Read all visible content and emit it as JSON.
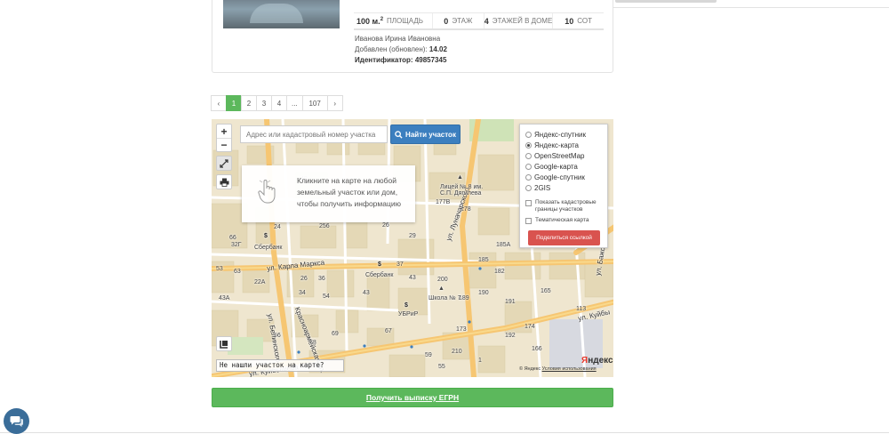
{
  "listing": {
    "area_value": "100 м.",
    "area_sup": "2",
    "area_label": "ПЛОЩАДЬ",
    "floor_value": "0",
    "floor_label": "ЭТАЖ",
    "floors_value": "4",
    "floors_label": "ЭТАЖЕЙ В ДОМЕ",
    "land_value": "10",
    "land_label": "СОТ",
    "owner": "Иванова Ирина Ивановна",
    "added_label": "Добавлен (обновлен):",
    "added_value": "14.02",
    "id_label": "Идентификатор:",
    "id_value": "49857345"
  },
  "pagination": {
    "prev": "‹",
    "pages": [
      "1",
      "2",
      "3",
      "4",
      "...",
      "107"
    ],
    "active_page": "1",
    "next": "›"
  },
  "map": {
    "search_placeholder": "Адрес или кадастровый номер участка",
    "search_button": "Найти участок",
    "zoom_in": "+",
    "zoom_out": "−",
    "hint_text": "Кликните на карте на любой земельный участок или дом, чтобы получить информацию",
    "layers": [
      {
        "label": "Яндекс-спутник",
        "selected": false
      },
      {
        "label": "Яндекс-карта",
        "selected": true
      },
      {
        "label": "OpenStreetMap",
        "selected": false
      },
      {
        "label": "Google-карта",
        "selected": false
      },
      {
        "label": "Google-спутник",
        "selected": false
      },
      {
        "label": "2GIS",
        "selected": false
      }
    ],
    "cadastral_checkbox": "Показать кадастровые границы участков",
    "thematic_checkbox": "Тематическая карта",
    "share_button": "Поделиться ссылкой",
    "not_found": "Не нашли участок на карте?",
    "copyright": "© Яндекс",
    "terms": "Условия использования",
    "logo_y": "Я",
    "logo_rest": "ндекс",
    "streets": {
      "karla_marksa": "ул. Карла Маркса",
      "krasnoarmeyskaya": "Красноармейская ул.",
      "lunacharskogo": "ул. Луначарского",
      "kuibysheva_left": "ул. Куйбышева",
      "kuibysheva_right": "ул. Куйбы",
      "belinskogo": "ул. Белинского",
      "bazhova": "ул. Бажова"
    },
    "pois": {
      "sberbank_1": "Сбербанк",
      "sberbank_2": "Сбербанк",
      "ubrir": "УБРиР",
      "school": "Школа № 7",
      "lyceum_line1": "Лицей № 8 им.",
      "lyceum_line2": "С.П. Дягилева"
    },
    "house_numbers": [
      "66",
      "32Г",
      "24",
      "53",
      "63",
      "22А",
      "26",
      "34",
      "36",
      "43",
      "43А",
      "54",
      "69",
      "256",
      "26",
      "29",
      "37",
      "43",
      "67",
      "59",
      "55",
      "78",
      "56",
      "185",
      "178",
      "177В",
      "185А",
      "182",
      "189",
      "190",
      "191",
      "192",
      "200",
      "210",
      "173",
      "156",
      "165",
      "166",
      "174",
      "113",
      "1",
      "48"
    ]
  },
  "egrn_button": "Получить выписку ЕГРН",
  "icons": [
    "search-icon",
    "fullscreen-icon",
    "print-icon",
    "hand-pointer-icon",
    "ruler-icon",
    "chat-icon",
    "dollar-icon",
    "school-icon",
    "bank-icon"
  ]
}
